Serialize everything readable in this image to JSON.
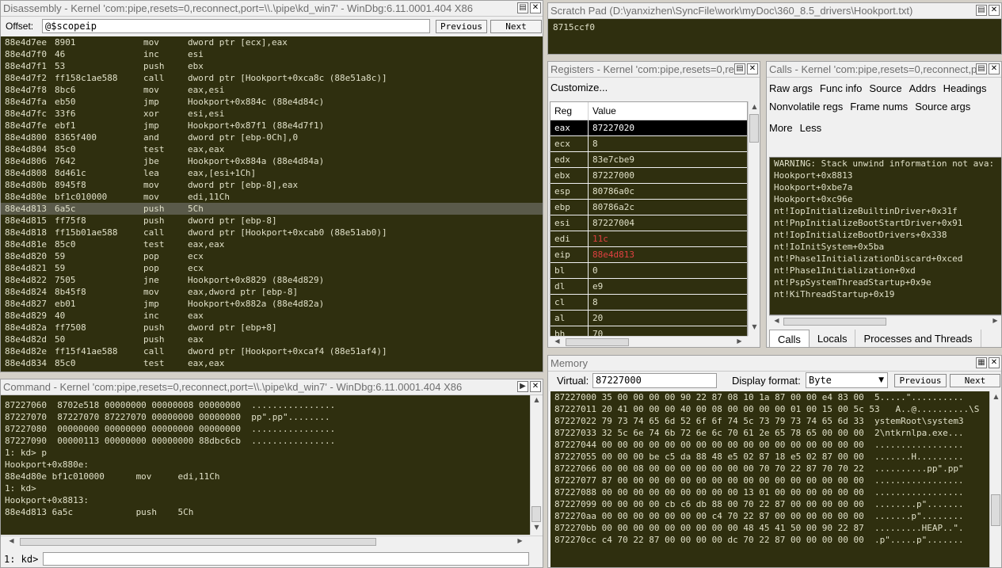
{
  "disassembly": {
    "title": "Disassembly - Kernel 'com:pipe,resets=0,reconnect,port=\\\\.\\pipe\\kd_win7' - WinDbg:6.11.0001.404 X86",
    "offset_label": "Offset:",
    "offset_value": "@$scopeip",
    "previous_label": "Previous",
    "next_label": "Next",
    "lines": [
      {
        "addr": "88e4d7ee",
        "bytes": "8901",
        "mn": "mov",
        "op": "dword ptr [ecx],eax",
        "hl": false
      },
      {
        "addr": "88e4d7f0",
        "bytes": "46",
        "mn": "inc",
        "op": "esi",
        "hl": false
      },
      {
        "addr": "88e4d7f1",
        "bytes": "53",
        "mn": "push",
        "op": "ebx",
        "hl": false
      },
      {
        "addr": "88e4d7f2",
        "bytes": "ff158c1ae588",
        "mn": "call",
        "op": "dword ptr [Hookport+0xca8c (88e51a8c)]",
        "hl": false
      },
      {
        "addr": "88e4d7f8",
        "bytes": "8bc6",
        "mn": "mov",
        "op": "eax,esi",
        "hl": false
      },
      {
        "addr": "88e4d7fa",
        "bytes": "eb50",
        "mn": "jmp",
        "op": "Hookport+0x884c (88e4d84c)",
        "hl": false
      },
      {
        "addr": "88e4d7fc",
        "bytes": "33f6",
        "mn": "xor",
        "op": "esi,esi",
        "hl": false
      },
      {
        "addr": "88e4d7fe",
        "bytes": "ebf1",
        "mn": "jmp",
        "op": "Hookport+0x87f1 (88e4d7f1)",
        "hl": false
      },
      {
        "addr": "88e4d800",
        "bytes": "8365f400",
        "mn": "and",
        "op": "dword ptr [ebp-0Ch],0",
        "hl": false
      },
      {
        "addr": "88e4d804",
        "bytes": "85c0",
        "mn": "test",
        "op": "eax,eax",
        "hl": false
      },
      {
        "addr": "88e4d806",
        "bytes": "7642",
        "mn": "jbe",
        "op": "Hookport+0x884a (88e4d84a)",
        "hl": false
      },
      {
        "addr": "88e4d808",
        "bytes": "8d461c",
        "mn": "lea",
        "op": "eax,[esi+1Ch]",
        "hl": false
      },
      {
        "addr": "88e4d80b",
        "bytes": "8945f8",
        "mn": "mov",
        "op": "dword ptr [ebp-8],eax",
        "hl": false
      },
      {
        "addr": "88e4d80e",
        "bytes": "bf1c010000",
        "mn": "mov",
        "op": "edi,11Ch",
        "hl": false
      },
      {
        "addr": "88e4d813",
        "bytes": "6a5c",
        "mn": "push",
        "op": "5Ch",
        "hl": true
      },
      {
        "addr": "88e4d815",
        "bytes": "ff75f8",
        "mn": "push",
        "op": "dword ptr [ebp-8]",
        "hl": false
      },
      {
        "addr": "88e4d818",
        "bytes": "ff15b01ae588",
        "mn": "call",
        "op": "dword ptr [Hookport+0xcab0 (88e51ab0)]",
        "hl": false
      },
      {
        "addr": "88e4d81e",
        "bytes": "85c0",
        "mn": "test",
        "op": "eax,eax",
        "hl": false
      },
      {
        "addr": "88e4d820",
        "bytes": "59",
        "mn": "pop",
        "op": "ecx",
        "hl": false
      },
      {
        "addr": "88e4d821",
        "bytes": "59",
        "mn": "pop",
        "op": "ecx",
        "hl": false
      },
      {
        "addr": "88e4d822",
        "bytes": "7505",
        "mn": "jne",
        "op": "Hookport+0x8829 (88e4d829)",
        "hl": false
      },
      {
        "addr": "88e4d824",
        "bytes": "8b45f8",
        "mn": "mov",
        "op": "eax,dword ptr [ebp-8]",
        "hl": false
      },
      {
        "addr": "88e4d827",
        "bytes": "eb01",
        "mn": "jmp",
        "op": "Hookport+0x882a (88e4d82a)",
        "hl": false
      },
      {
        "addr": "88e4d829",
        "bytes": "40",
        "mn": "inc",
        "op": "eax",
        "hl": false
      },
      {
        "addr": "88e4d82a",
        "bytes": "ff7508",
        "mn": "push",
        "op": "dword ptr [ebp+8]",
        "hl": false
      },
      {
        "addr": "88e4d82d",
        "bytes": "50",
        "mn": "push",
        "op": "eax",
        "hl": false
      },
      {
        "addr": "88e4d82e",
        "bytes": "ff15f41ae588",
        "mn": "call",
        "op": "dword ptr [Hookport+0xcaf4 (88e51af4)]",
        "hl": false
      },
      {
        "addr": "88e4d834",
        "bytes": "85c0",
        "mn": "test",
        "op": "eax,eax",
        "hl": false
      }
    ]
  },
  "command": {
    "title": "Command - Kernel 'com:pipe,resets=0,reconnect,port=\\\\.\\pipe\\kd_win7' - WinDbg:6.11.0001.404 X86",
    "lines": [
      "87227060  8702e518 00000000 00000008 00000000  ................",
      "87227070  87227070 87227070 00000000 00000000  pp\".pp\"........",
      "87227080  00000000 00000000 00000000 00000000  ................",
      "87227090  00000113 00000000 00000000 88dbc6cb  ................",
      "1: kd> p",
      "Hookport+0x880e:",
      "88e4d80e bf1c010000      mov     edi,11Ch",
      "1: kd>",
      "Hookport+0x8813:",
      "88e4d813 6a5c            push    5Ch"
    ],
    "prompt": "1: kd>",
    "input_value": ""
  },
  "scratch": {
    "title": "Scratch Pad (D:\\yanxizhen\\SyncFile\\work\\myDoc\\360_8.5_drivers\\Hookport.txt)",
    "content": "8715ccf0"
  },
  "registers": {
    "title": "Registers - Kernel 'com:pipe,resets=0,re",
    "customize_label": "Customize...",
    "col_reg": "Reg",
    "col_value": "Value",
    "rows": [
      {
        "name": "eax",
        "value": "87227020",
        "changed": false,
        "selected": true
      },
      {
        "name": "ecx",
        "value": "8",
        "changed": false,
        "selected": false
      },
      {
        "name": "edx",
        "value": "83e7cbe9",
        "changed": false,
        "selected": false
      },
      {
        "name": "ebx",
        "value": "87227000",
        "changed": false,
        "selected": false
      },
      {
        "name": "esp",
        "value": "80786a0c",
        "changed": false,
        "selected": false
      },
      {
        "name": "ebp",
        "value": "80786a2c",
        "changed": false,
        "selected": false
      },
      {
        "name": "esi",
        "value": "87227004",
        "changed": false,
        "selected": false
      },
      {
        "name": "edi",
        "value": "11c",
        "changed": true,
        "selected": false
      },
      {
        "name": "eip",
        "value": "88e4d813",
        "changed": true,
        "selected": false
      },
      {
        "name": "bl",
        "value": "0",
        "changed": false,
        "selected": false
      },
      {
        "name": "dl",
        "value": "e9",
        "changed": false,
        "selected": false
      },
      {
        "name": "cl",
        "value": "8",
        "changed": false,
        "selected": false
      },
      {
        "name": "al",
        "value": "20",
        "changed": false,
        "selected": false
      },
      {
        "name": "bh",
        "value": "70",
        "changed": false,
        "selected": false
      }
    ]
  },
  "calls": {
    "title": "Calls - Kernel 'com:pipe,resets=0,reconnect,p",
    "row1": [
      "Raw args",
      "Func info",
      "Source",
      "Addrs",
      "Headings"
    ],
    "row2": [
      "Nonvolatile regs",
      "Frame nums",
      "Source args"
    ],
    "row3": [
      "More",
      "Less"
    ],
    "stack": [
      "WARNING: Stack unwind information not ava:",
      "Hookport+0x8813",
      "Hookport+0xbe7a",
      "Hookport+0xc96e",
      "nt!IopInitializeBuiltinDriver+0x31f",
      "nt!PnpInitializeBootStartDriver+0x91",
      "nt!IopInitializeBootDrivers+0x338",
      "nt!IoInitSystem+0x5ba",
      "nt!Phase1InitializationDiscard+0xced",
      "nt!Phase1Initialization+0xd",
      "nt!PspSystemThreadStartup+0x9e",
      "nt!KiThreadStartup+0x19"
    ],
    "tabs": [
      "Calls",
      "Locals",
      "Processes and Threads"
    ]
  },
  "memory": {
    "title": "Memory",
    "virtual_label": "Virtual:",
    "virtual_value": "87227000",
    "display_format_label": "Display format:",
    "display_format_value": "Byte",
    "previous_label": "Previous",
    "next_label": "Next",
    "lines": [
      "87227000 35 00 00 00 00 90 22 87 08 10 1a 87 00 00 e4 83 00  5.....\"..........",
      "87227011 20 41 00 00 00 40 00 08 00 00 00 00 01 00 15 00 5c 53   A..@..........\\S",
      "87227022 79 73 74 65 6d 52 6f 6f 74 5c 73 79 73 74 65 6d 33  ystemRoot\\system3",
      "87227033 32 5c 6e 74 6b 72 6e 6c 70 61 2e 65 78 65 00 00 00  2\\ntkrnlpa.exe...",
      "87227044 00 00 00 00 00 00 00 00 00 00 00 00 00 00 00 00 00  .................",
      "87227055 00 00 00 be c5 da 88 48 e5 02 87 18 e5 02 87 00 00  .......H.........",
      "87227066 00 00 08 00 00 00 00 00 00 00 70 70 22 87 70 70 22  ..........pp\".pp\"",
      "87227077 87 00 00 00 00 00 00 00 00 00 00 00 00 00 00 00 00  .................",
      "87227088 00 00 00 00 00 00 00 00 00 13 01 00 00 00 00 00 00  .................",
      "87227099 00 00 00 00 cb c6 db 88 00 70 22 87 00 00 00 00 00  ........p\".......",
      "872270aa 00 00 00 00 00 00 00 c4 70 22 87 00 00 00 00 00 00  .......p\"........",
      "872270bb 00 00 00 00 00 00 00 00 00 48 45 41 50 00 90 22 87  .........HEAP..\".",
      "872270cc c4 70 22 87 00 00 00 00 dc 70 22 87 00 00 00 00 00  .p\".....p\"......."
    ]
  }
}
